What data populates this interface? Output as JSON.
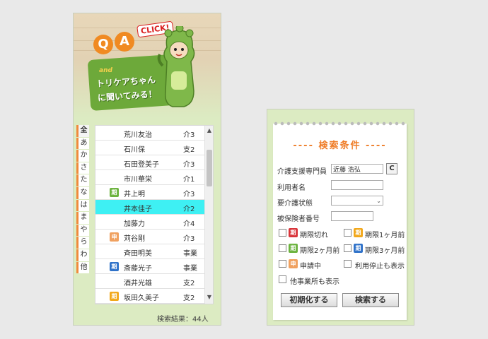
{
  "banner": {
    "q_letter": "Q",
    "a_letter": "A",
    "and_text": "and",
    "click_text": "CLICK!",
    "title_line1": "トリケアちゃん",
    "title_line2": "に聞いてみる！"
  },
  "kana_tabs": [
    "全",
    "あ",
    "か",
    "さ",
    "た",
    "な",
    "は",
    "ま",
    "や",
    "ら",
    "わ",
    "他"
  ],
  "residents": [
    {
      "name": "荒川友治",
      "level": "介3",
      "badge": ""
    },
    {
      "name": "石川保",
      "level": "支2",
      "badge": ""
    },
    {
      "name": "石田登美子",
      "level": "介3",
      "badge": ""
    },
    {
      "name": "市川華栄",
      "level": "介1",
      "badge": ""
    },
    {
      "name": "井上明",
      "level": "介3",
      "badge": "期"
    },
    {
      "name": "井本佳子",
      "level": "介2",
      "badge": ""
    },
    {
      "name": "加藤力",
      "level": "介4",
      "badge": ""
    },
    {
      "name": "苅谷剛",
      "level": "介3",
      "badge": "申"
    },
    {
      "name": "斉田明美",
      "level": "事業",
      "badge": ""
    },
    {
      "name": "斎藤光子",
      "level": "事業",
      "badge": "期"
    },
    {
      "name": "酒井光雄",
      "level": "支2",
      "badge": ""
    },
    {
      "name": "坂田久美子",
      "level": "支2",
      "badge": "期"
    }
  ],
  "selected_index": 5,
  "result_count": "検索結果：44人",
  "search": {
    "title": "---- 検索条件 ----",
    "care_manager_label": "介護支援専門員",
    "care_manager_value": "近藤 浩弘",
    "clear_label": "C",
    "user_name_label": "利用者名",
    "user_name_value": "",
    "care_level_label": "要介護状態",
    "care_level_value": "",
    "insured_number_label": "被保険者番号",
    "insured_number_value": "",
    "checks": {
      "expired": "期限切れ",
      "one_month": "期限1ヶ月前",
      "two_month": "期限2ヶ月前",
      "three_month": "期限3ヶ月前",
      "applying": "申請中",
      "show_suspended": "利用停止も表示",
      "other_offices": "他事業所も表示"
    },
    "reset_label": "初期化する",
    "search_label": "検索する"
  },
  "badges": {
    "term": "期",
    "apply": "申"
  },
  "colors": {
    "badge_green": "#6cb33f",
    "badge_orange": "#f0a160",
    "badge_red": "#d9353b",
    "badge_yellow": "#f2a81b",
    "badge_blue": "#2f72c9",
    "accent_orange": "#ef7d28",
    "selected_row": "#3ef0f3"
  }
}
